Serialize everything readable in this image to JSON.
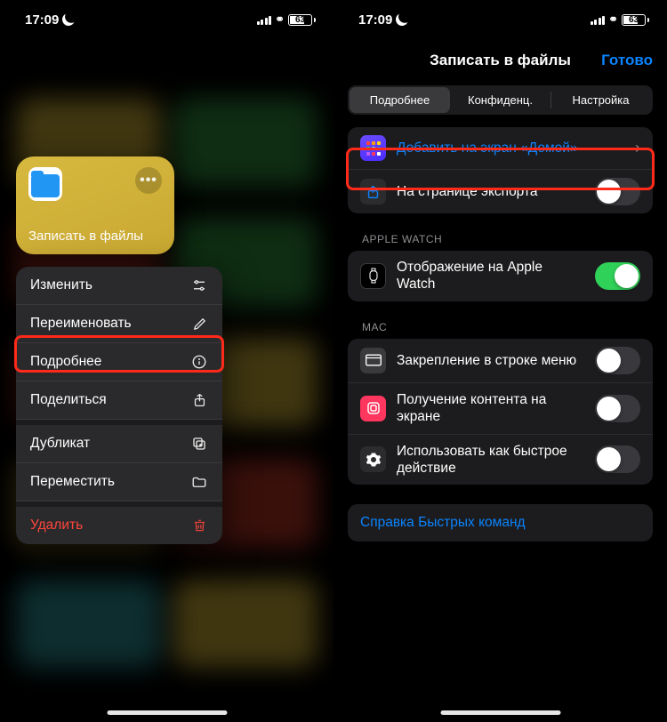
{
  "status": {
    "time": "17:09",
    "battery_pct": "63"
  },
  "left": {
    "shortcut_title": "Записать в файлы",
    "menu": {
      "edit": "Изменить",
      "rename": "Переименовать",
      "details": "Подробнее",
      "share": "Поделиться",
      "duplicate": "Дубликат",
      "move": "Переместить",
      "delete": "Удалить"
    }
  },
  "right": {
    "title": "Записать в файлы",
    "done": "Готово",
    "tabs": {
      "details": "Подробнее",
      "privacy": "Конфиденц.",
      "setup": "Настройка"
    },
    "rows": {
      "add_home": "Добавить на экран «Домой»",
      "export_sheet": "На странице экспорта",
      "apple_watch_header": "Apple Watch",
      "apple_watch": "Отображение на Apple Watch",
      "mac_header": "Mac",
      "pin_menubar": "Закрепление в строке меню",
      "receive_screen": "Получение контента на экране",
      "quick_action": "Использовать как быстрое действие",
      "help": "Справка Быстрых команд"
    },
    "toggles": {
      "export_sheet": false,
      "apple_watch": true,
      "pin_menubar": false,
      "receive_screen": false,
      "quick_action": false
    }
  }
}
